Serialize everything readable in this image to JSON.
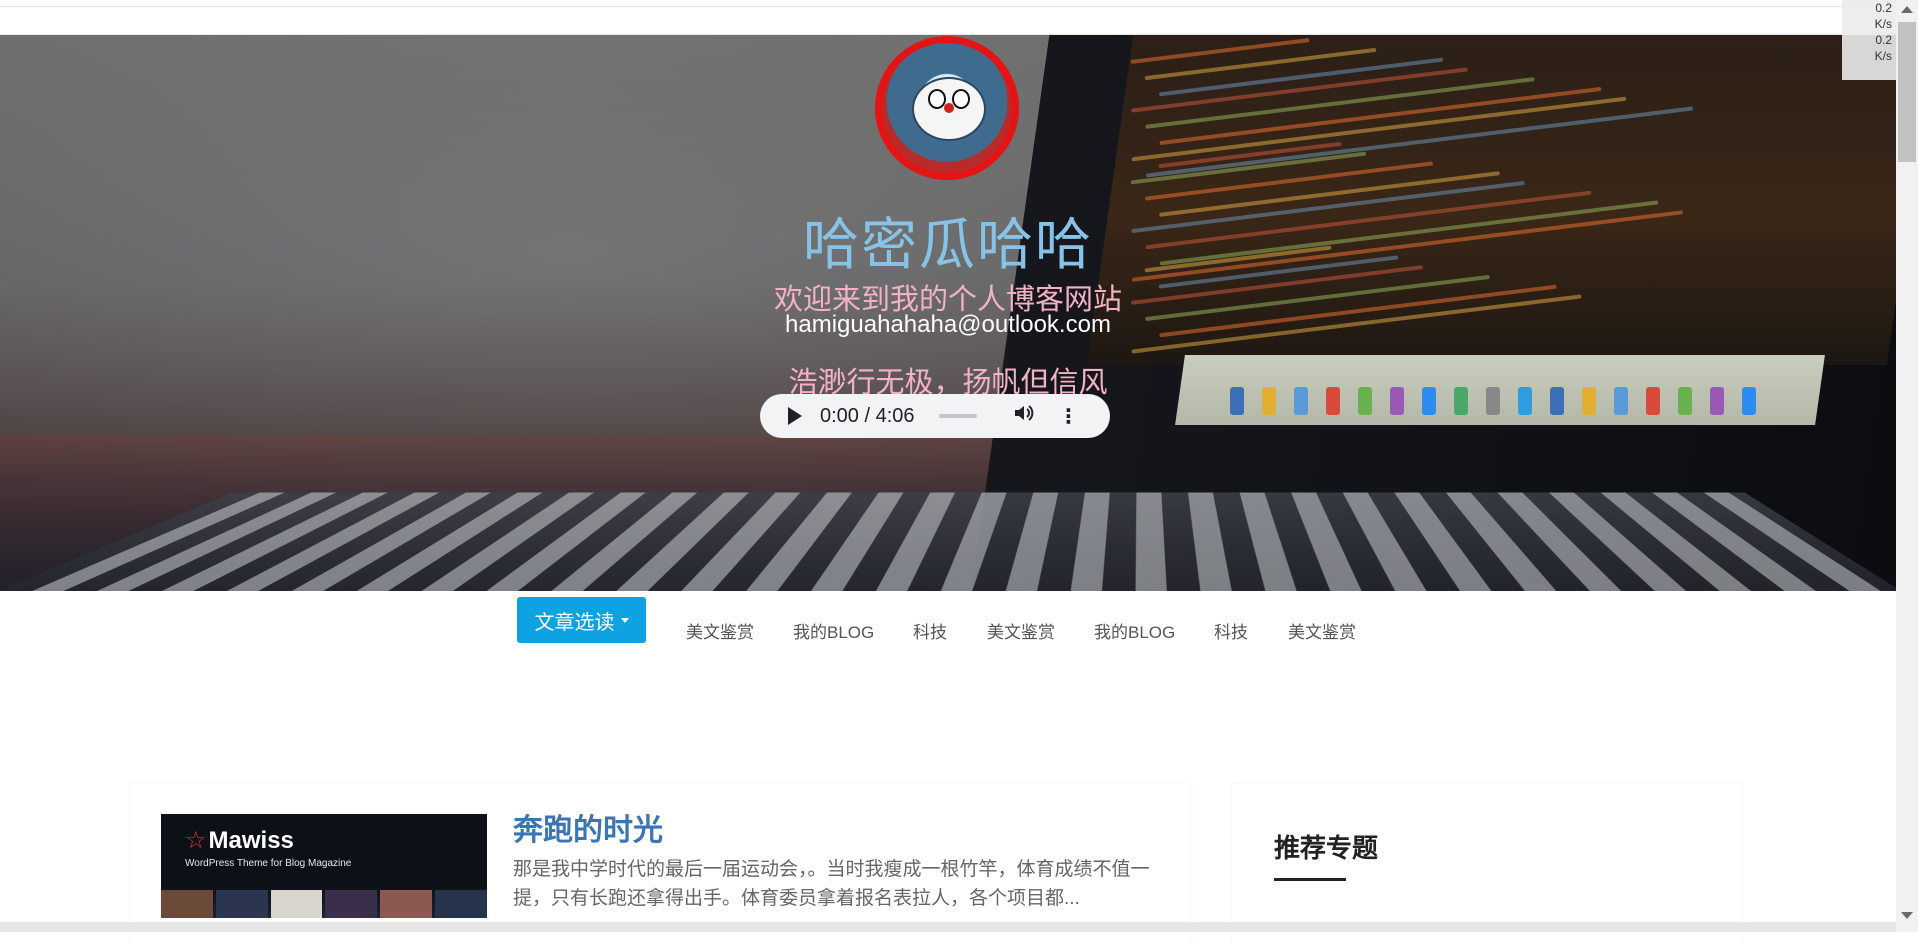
{
  "header": {
    "site_title": "哈密瓜哈哈",
    "subtitle": "欢迎来到我的个人博客网站",
    "email": "hamiguahahaha@outlook.com",
    "motto": "浩渺行无极，扬帆但信风"
  },
  "audio_player": {
    "time": "0:00 / 4:06",
    "progress": 0
  },
  "nav": {
    "dropdown_label": "文章选读",
    "links": [
      "美文鉴赏",
      "我的BLOG",
      "科技",
      "美文鉴赏",
      "我的BLOG",
      "科技",
      "美文鉴赏"
    ]
  },
  "post": {
    "thumbnail_brand": "Mawiss",
    "thumbnail_tagline": "WordPress Theme for Blog Magazine",
    "title": "奔跑的时光",
    "excerpt": "那是我中学时代的最后一届运动会，。当时我瘦成一根竹竿，体育成绩不值一提，只有长跑还拿得出手。体育委员拿着报名表拉人，各个项目都..."
  },
  "sidebar": {
    "title": "推荐专题"
  },
  "net_monitor": {
    "up": "0.2",
    "up_unit": "K/s",
    "down": "0.2",
    "down_unit": "K/s"
  },
  "colors": {
    "accent": "#0ea2e3",
    "title": "#87c3e6",
    "subtitle": "#f3b2c3",
    "post_title": "#3a76b4"
  }
}
